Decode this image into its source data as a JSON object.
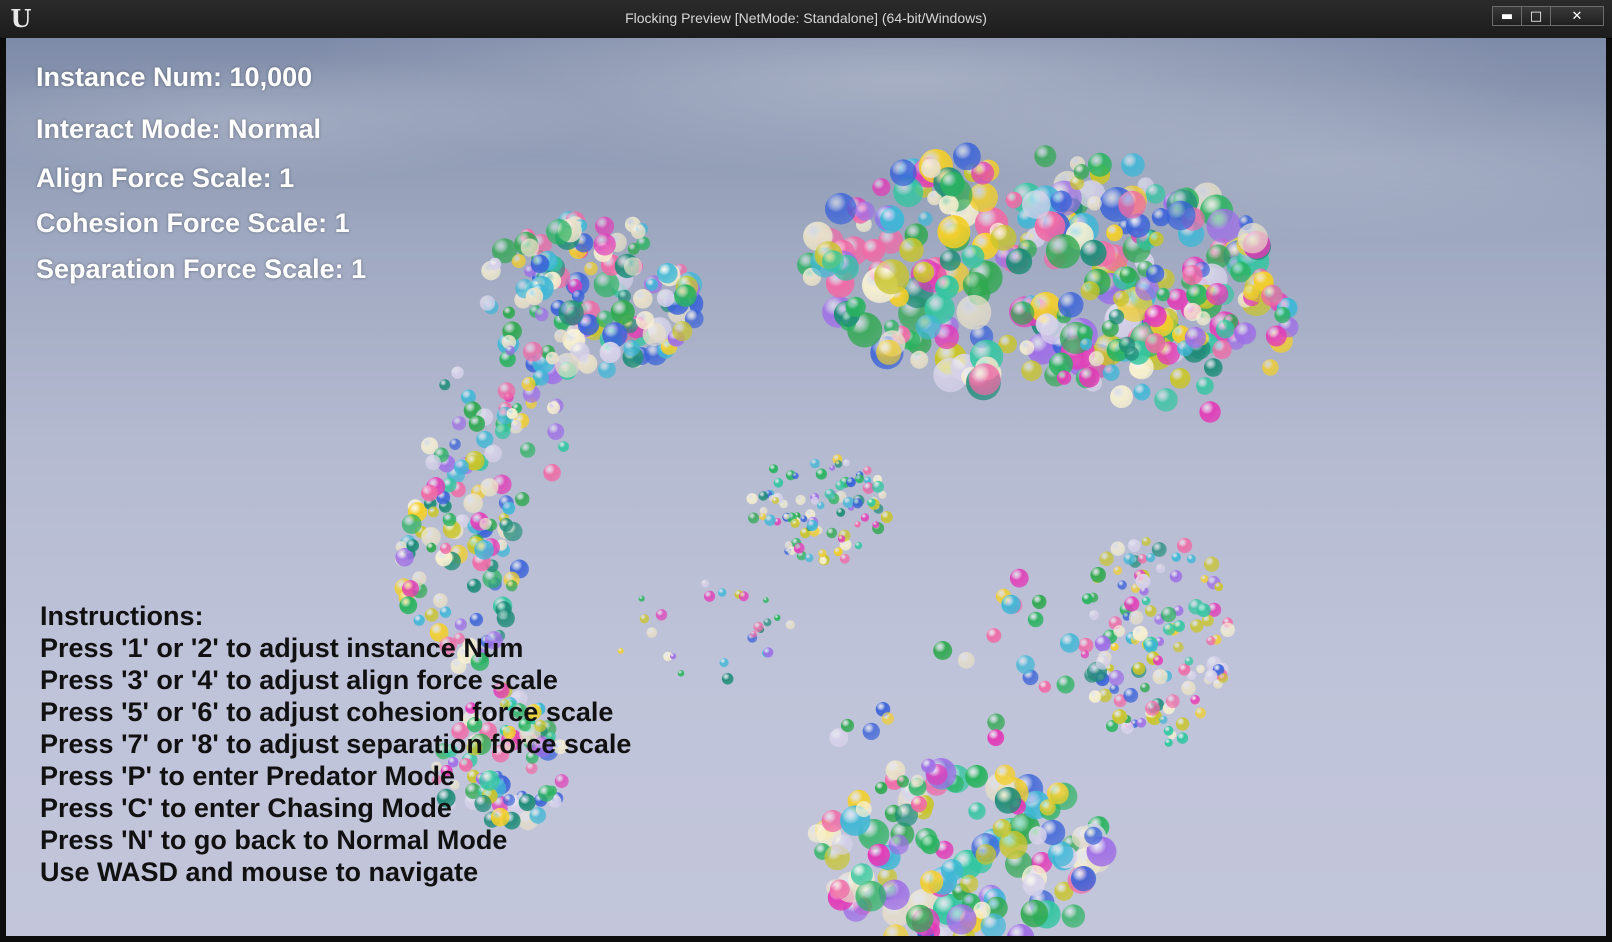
{
  "window": {
    "title": "Flocking Preview [NetMode: Standalone] (64-bit/Windows)",
    "logo_text": "U",
    "minimize_glyph": "▬",
    "maximize_glyph": "□",
    "close_glyph": "✕"
  },
  "hud": {
    "instance_num": "Instance Num: 10,000",
    "interact_mode": "Interact Mode: Normal",
    "align_force": "Align Force Scale: 1",
    "cohesion_force": "Cohesion Force Scale: 1",
    "separation_force": "Separation Force Scale: 1"
  },
  "instructions": {
    "heading": "Instructions:",
    "lines": [
      "Press '1' or '2' to adjust instance Num",
      "Press '3' or '4' to adjust align force scale",
      "Press '5' or '6' to adjust cohesion force scale",
      "Press '7' or '8' to adjust separation force scale",
      "Press 'P' to enter Predator Mode",
      "Press 'C' to enter Chasing Mode",
      "Press 'N' to go back to Normal Mode",
      "Use WASD and mouse to navigate"
    ]
  },
  "colors": {
    "sphere_palette": [
      "#e23bb7",
      "#3fb7d6",
      "#32c6a0",
      "#f3cf2a",
      "#9e6ee6",
      "#3a62d8",
      "#2fa84f",
      "#e8e0c8",
      "#d7d2ea",
      "#f06aa6",
      "#29b35f",
      "#c9c52a",
      "#1f8c79",
      "#f7f0d0"
    ]
  }
}
